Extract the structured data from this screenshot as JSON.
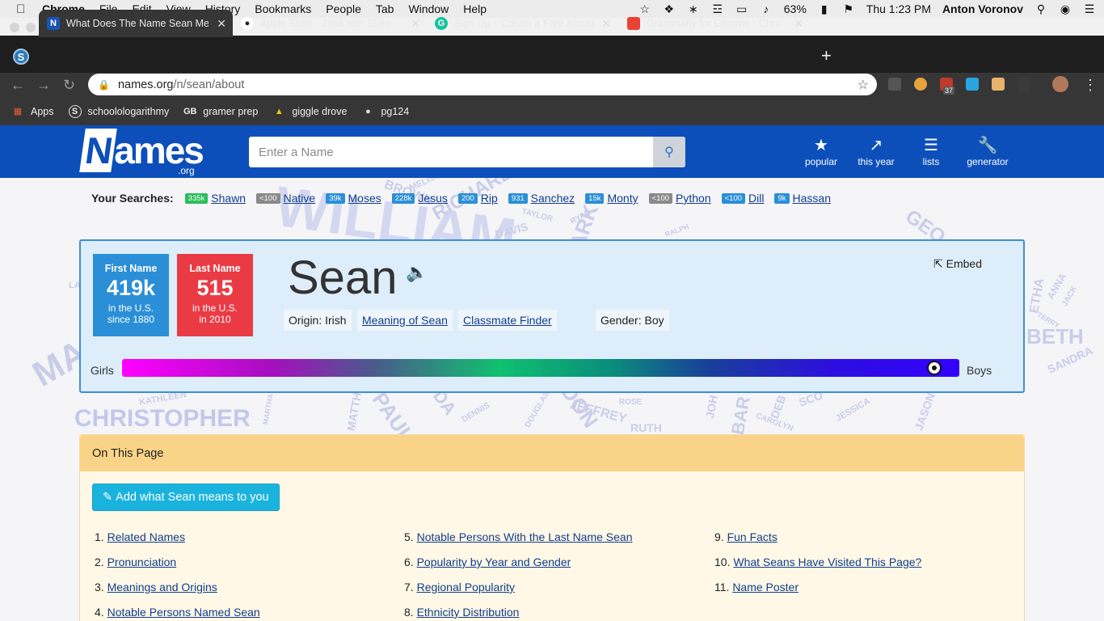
{
  "menubar": {
    "app": "Chrome",
    "items": [
      "File",
      "Edit",
      "View",
      "History",
      "Bookmarks",
      "People",
      "Tab",
      "Window",
      "Help"
    ],
    "battery": "63%",
    "clock": "Thu 1:23 PM",
    "user": "Anton Voronov"
  },
  "tabs": [
    {
      "title": "What Does The Name Sean Me",
      "favicon": "N",
      "favicon_color": "#1a53b8"
    },
    {
      "title": "Apple Store - Zoek een Store -",
      "favicon": "globe-icon",
      "favicon_color": "#2a2a2a"
    },
    {
      "title": "Sign Up – Create a Free Accou",
      "favicon": "G",
      "favicon_color": "#15c39a"
    },
    {
      "title": "Grammarly for Chrome - Chro",
      "favicon": "webstore-icon",
      "favicon_color": "#e94235"
    }
  ],
  "omnibox": {
    "host": "names.org",
    "path": "/n/sean/about"
  },
  "extensions": {
    "badge_count": "37"
  },
  "bookmarks": [
    {
      "label": "Apps",
      "icon": "apps-grid-icon"
    },
    {
      "label": "schoolologarithmy",
      "icon": "S"
    },
    {
      "label": "gramer prep",
      "icon": "GB"
    },
    {
      "label": "giggle drove",
      "icon": "drive-icon"
    },
    {
      "label": "pg124",
      "icon": "globe-icon"
    }
  ],
  "site": {
    "logo": "Names",
    "logo_tld": ".org",
    "search_placeholder": "Enter a Name",
    "nav": [
      {
        "label": "popular",
        "icon": "star-icon"
      },
      {
        "label": "this year",
        "icon": "trend-icon"
      },
      {
        "label": "lists",
        "icon": "list-icon"
      },
      {
        "label": "generator",
        "icon": "wrench-icon"
      }
    ]
  },
  "your_searches": {
    "label": "Your Searches:",
    "items": [
      {
        "count": "335k",
        "name": "Shawn",
        "color": "#2bbd5c"
      },
      {
        "count": "<100",
        "name": "Native",
        "color": "#8a8a8a"
      },
      {
        "count": "39k",
        "name": "Moses",
        "color": "#2b8fd8"
      },
      {
        "count": "228k",
        "name": "Jesus",
        "color": "#2b8fd8"
      },
      {
        "count": "200",
        "name": "Rip",
        "color": "#2b8fd8"
      },
      {
        "count": "931",
        "name": "Sanchez",
        "color": "#2b8fd8"
      },
      {
        "count": "15k",
        "name": "Monty",
        "color": "#2b8fd8"
      },
      {
        "count": "<100",
        "name": "Python",
        "color": "#8a8a8a"
      },
      {
        "count": "<100",
        "name": "Dill",
        "color": "#2b8fd8"
      },
      {
        "count": "9k",
        "name": "Hassan",
        "color": "#2b8fd8"
      }
    ]
  },
  "name_card": {
    "name": "Sean",
    "first_name": {
      "label": "First Name",
      "value": "419k",
      "line1": "in the U.S.",
      "line2": "since 1880",
      "color": "#2b8fd8"
    },
    "last_name": {
      "label": "Last Name",
      "value": "515",
      "line1": "in the U.S.",
      "line2": "in 2010",
      "color": "#ea3b45"
    },
    "origin": "Origin: Irish",
    "meaning_link": "Meaning of Sean",
    "classmate_link": "Classmate Finder",
    "gender": "Gender: Boy",
    "embed": "Embed",
    "girls_label": "Girls",
    "boys_label": "Boys",
    "boy_fraction": 0.97
  },
  "background_cloud": [
    "WILLIAM",
    "CHRISTOPHER",
    "BROWN",
    "RICHARD",
    "MELISSA",
    "TAYLOR",
    "DAVIS",
    "RYAN",
    "RALPH",
    "MARK",
    "GEO",
    "ANNA",
    "BETH",
    "TERRY",
    "JACK",
    "SANDRA",
    "KATHLEEN",
    "PAUL",
    "DON",
    "JEFFREY",
    "RUTH",
    "ROSE",
    "DENNIS",
    "DOUGLAS",
    "CAROLYN",
    "JESSICA",
    "JASON",
    "DEB",
    "MATTH",
    "MARTHA",
    "JOH",
    "BAR",
    "SCO",
    "DA",
    "MA",
    "ETHA",
    "LA"
  ],
  "on_this_page": {
    "heading": "On This Page",
    "add_button": "Add what Sean means to you",
    "items": [
      "Related Names",
      "Pronunciation",
      "Meanings and Origins",
      "Notable Persons Named Sean",
      "Notable Persons With the Last Name Sean",
      "Popularity by Year and Gender",
      "Regional Popularity",
      "Ethnicity Distribution",
      "Fun Facts",
      "What Seans Have Visited This Page?",
      "Name Poster"
    ]
  }
}
